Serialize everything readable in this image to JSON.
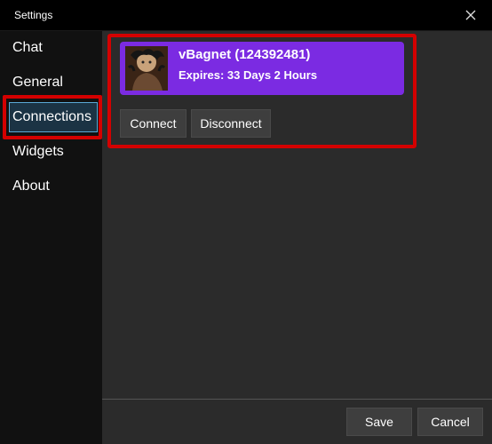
{
  "window": {
    "title": "Settings"
  },
  "sidebar": {
    "items": [
      {
        "label": "Chat"
      },
      {
        "label": "General"
      },
      {
        "label": "Connections"
      },
      {
        "label": "Widgets"
      },
      {
        "label": "About"
      }
    ],
    "selected": "Connections"
  },
  "account": {
    "name": "vBagnet (124392481)",
    "expires": "Expires: 33 Days 2 Hours"
  },
  "actions": {
    "connect_label": "Connect",
    "disconnect_label": "Disconnect"
  },
  "footer": {
    "save_label": "Save",
    "cancel_label": "Cancel"
  },
  "colors": {
    "accent_purple": "#7b2be2",
    "highlight_red": "#d40000",
    "selected_border": "#5aa9d6"
  },
  "icons": {
    "close": "close-icon",
    "avatar": "avatar"
  }
}
